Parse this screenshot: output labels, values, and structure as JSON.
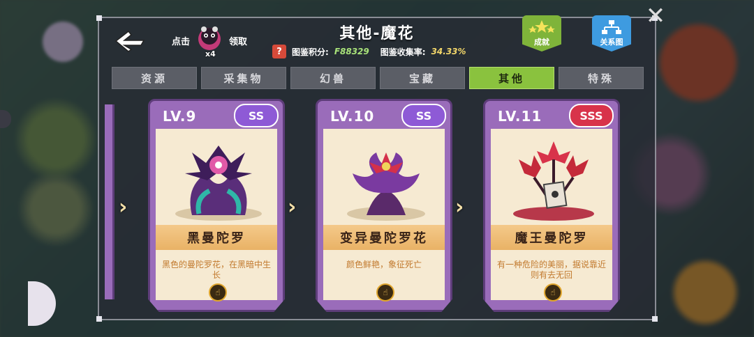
{
  "header": {
    "title": "其他-魔花",
    "claim": {
      "prefix": "点击",
      "count": "x4",
      "suffix": "领取"
    },
    "score_label": "图鉴积分:",
    "score_value": "F88329",
    "collect_label": "图鉴收集率:",
    "collect_value": "34.33%",
    "warn_glyph": "?",
    "achievement_label": "成就",
    "relation_label": "关系图"
  },
  "tabs": [
    {
      "label": "资源",
      "active": false
    },
    {
      "label": "采集物",
      "active": false
    },
    {
      "label": "幻兽",
      "active": false
    },
    {
      "label": "宝藏",
      "active": false
    },
    {
      "label": "其他",
      "active": true
    },
    {
      "label": "特殊",
      "active": false
    }
  ],
  "cards": [
    {
      "level": "LV.9",
      "rank": "SS",
      "name": "黑曼陀罗",
      "desc": "黑色的曼陀罗花，在黑暗中生长",
      "rank_color": "#8e5ad6"
    },
    {
      "level": "LV.10",
      "rank": "SS",
      "name": "变异曼陀罗花",
      "desc": "颜色鲜艳，象征死亡",
      "rank_color": "#8e5ad6"
    },
    {
      "level": "LV.11",
      "rank": "SSS",
      "name": "魔王曼陀罗",
      "desc": "有一种危险的美丽，据说靠近则有去无回",
      "rank_color": "#d8334a"
    }
  ],
  "icons": {
    "back": "back-arrow-icon",
    "close": "close-icon",
    "achievement": "stars-badge-icon",
    "relation": "relation-tree-icon",
    "coin": "hand-coin-icon"
  },
  "colors": {
    "tab_active": "#8ac23e",
    "card_frame": "#9a6cba",
    "achievement": "#7fb43a",
    "relation": "#3e9be0"
  }
}
